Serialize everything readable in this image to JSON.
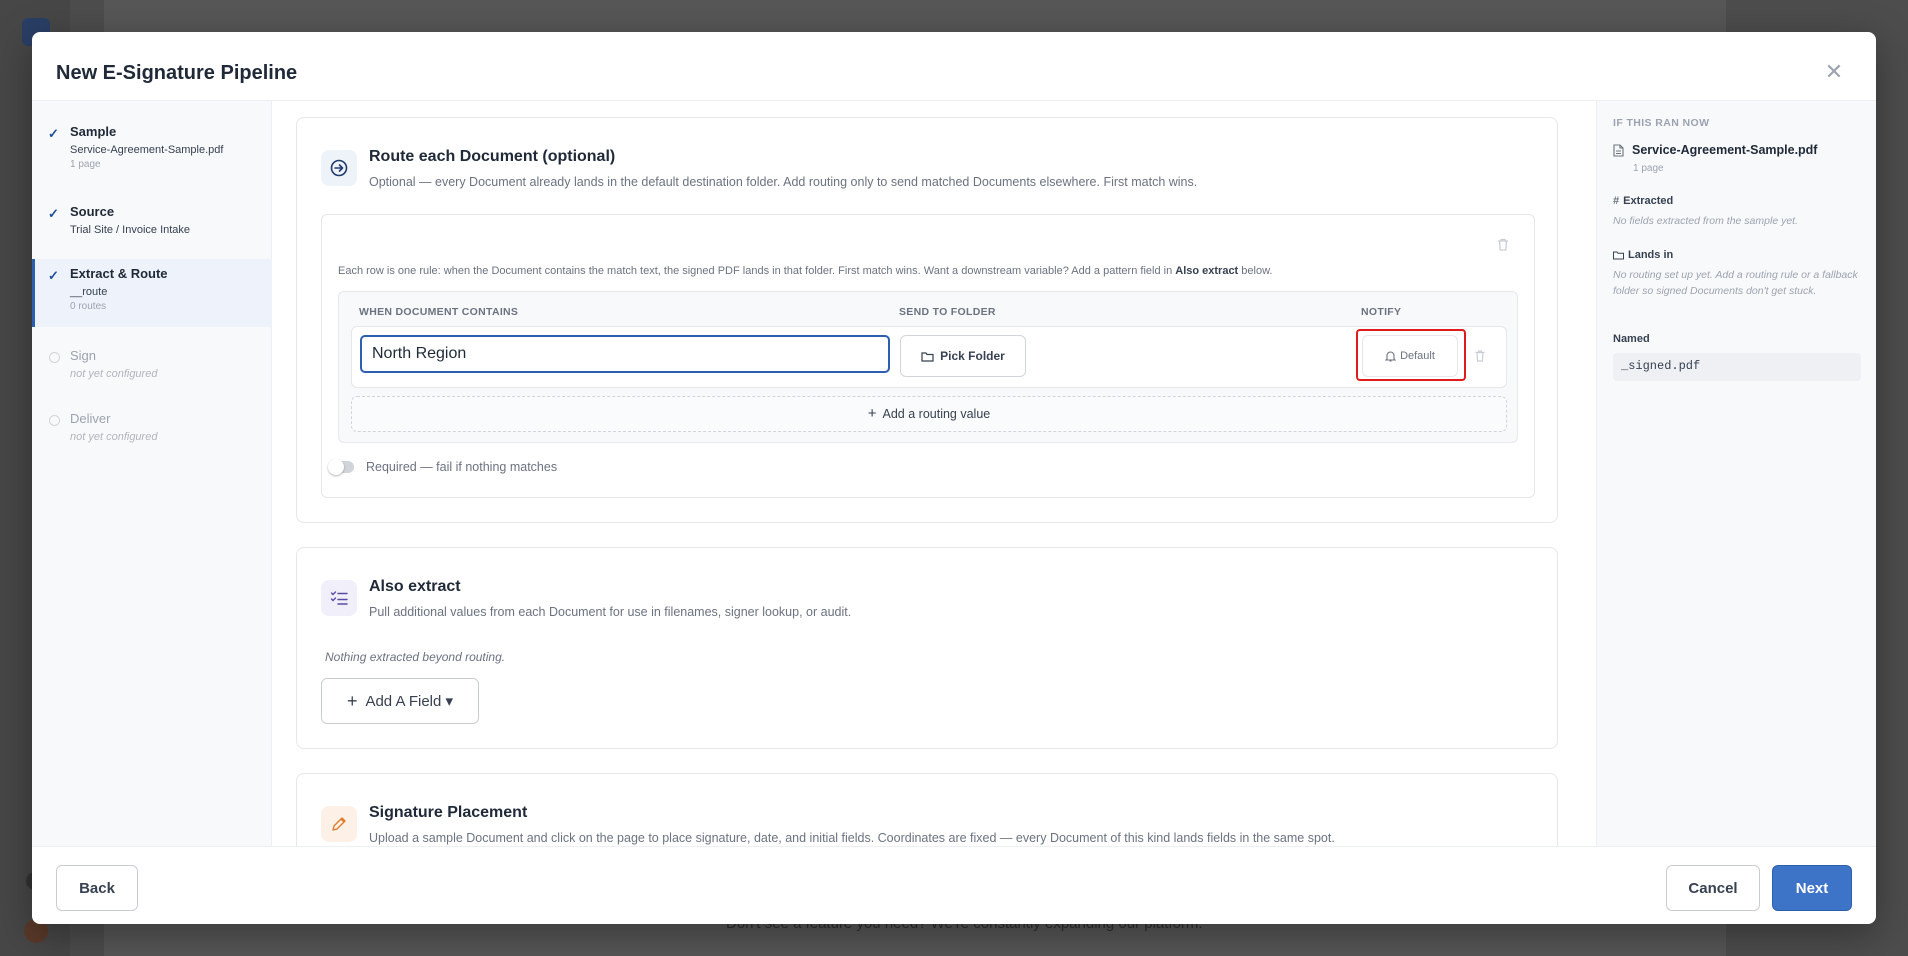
{
  "background": {
    "footer_text": "Don't see a feature you need? We're constantly expanding our platform."
  },
  "modal": {
    "title": "New E-Signature Pipeline"
  },
  "steps": [
    {
      "name": "Sample",
      "sub": "Service-Agreement-Sample.pdf",
      "sub2": "1 page",
      "status": "done"
    },
    {
      "name": "Source",
      "sub": "Trial Site / Invoice Intake",
      "status": "done"
    },
    {
      "name": "Extract & Route",
      "sub": "__route",
      "sub2": "0 routes",
      "status": "active"
    },
    {
      "name": "Sign",
      "sub": "not yet configured",
      "status": "pending"
    },
    {
      "name": "Deliver",
      "sub": "not yet configured",
      "status": "pending"
    }
  ],
  "routing": {
    "title": "Route each Document (optional)",
    "description": "Optional — every Document already lands in the default destination folder. Add routing only to send matched Documents elsewhere. First match wins.",
    "help_pre": "Each row is one rule: when the Document contains the match text, the signed PDF lands in that folder. First match wins. Want a downstream variable? Add a pattern field in ",
    "help_bold": "Also extract",
    "help_post": " below.",
    "col_contains": "WHEN DOCUMENT CONTAINS",
    "col_folder": "SEND TO FOLDER",
    "col_notify": "NOTIFY",
    "row_value": "North Region",
    "pick_folder_label": "Pick Folder",
    "notify_label": "Default",
    "add_value_label": "Add a routing value",
    "required_label": "Required — fail if nothing matches"
  },
  "also_extract": {
    "title": "Also extract",
    "description": "Pull additional values from each Document for use in filenames, signer lookup, or audit.",
    "empty_text": "Nothing extracted beyond routing.",
    "add_field_label": "Add A Field ▾"
  },
  "signature": {
    "title": "Signature Placement",
    "description": "Upload a sample Document and click on the page to place signature, date, and initial fields. Coordinates are fixed — every Document of this kind lands fields in the same spot."
  },
  "preview": {
    "heading": "IF THIS RAN NOW",
    "file_name": "Service-Agreement-Sample.pdf",
    "file_pages": "1 page",
    "extracted_label": "Extracted",
    "extracted_note": "No fields extracted from the sample yet.",
    "lands_label": "Lands in",
    "lands_note": "No routing set up yet. Add a routing rule or a fallback folder so signed Documents don't get stuck.",
    "named_label": "Named",
    "named_value": "_signed.pdf"
  },
  "footer": {
    "back_label": "Back",
    "cancel_label": "Cancel",
    "next_label": "Next"
  },
  "colors": {
    "accent": "#2d5fb0",
    "primary_button": "#3d74c8",
    "highlight": "#e01b1b"
  }
}
